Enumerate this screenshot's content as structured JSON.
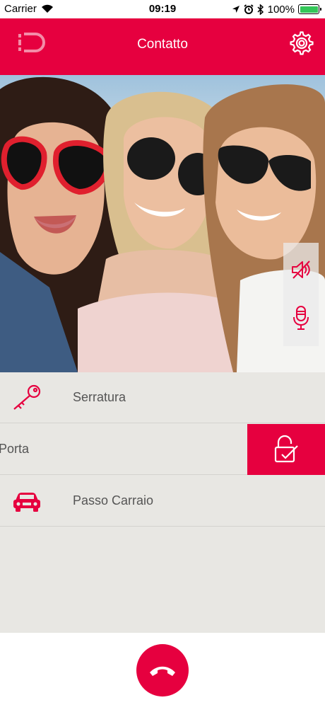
{
  "status_bar": {
    "carrier": "Carrier",
    "time": "09:19",
    "battery": "100%",
    "battery_level": 1.0,
    "icons": [
      "wifi-icon",
      "location-icon",
      "alarm-icon",
      "bluetooth-icon",
      "battery-icon"
    ]
  },
  "header": {
    "title": "Contatto",
    "left_icon": "logo-icon",
    "right_icon": "gear-icon"
  },
  "video": {
    "controls": [
      {
        "name": "mute-speaker",
        "icon": "speaker-muted-icon"
      },
      {
        "name": "microphone",
        "icon": "microphone-icon"
      }
    ]
  },
  "actions": [
    {
      "label": "Serratura",
      "icon": "key-icon"
    },
    {
      "label": "Porta",
      "icon": "door-icon",
      "action_icon": "unlock-check-icon"
    },
    {
      "label": "Passo Carraio",
      "icon": "car-icon"
    }
  ],
  "footer": {
    "hangup_icon": "phone-hangup-icon"
  },
  "colors": {
    "accent": "#e6003f",
    "list_bg": "#e8e7e3",
    "text": "#555555"
  }
}
